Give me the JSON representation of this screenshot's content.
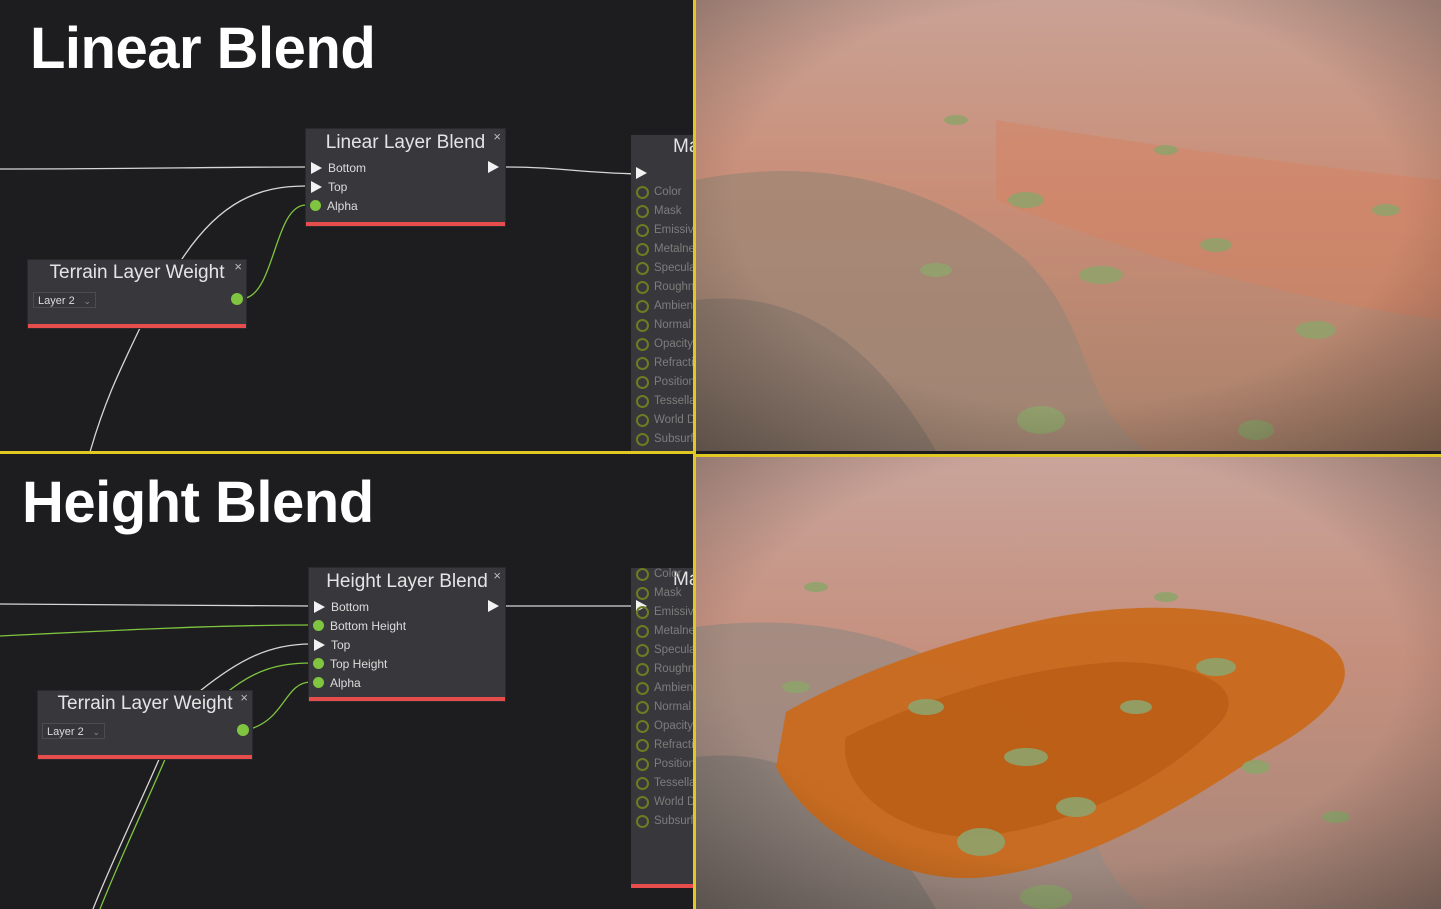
{
  "linear": {
    "title": "Linear Blend",
    "blend_node": {
      "title": "Linear Layer Blend",
      "close": "×",
      "pins": [
        "Bottom",
        "Top",
        "Alpha"
      ]
    },
    "weight_node": {
      "title": "Terrain Layer Weight",
      "close": "×",
      "layer": "Layer 2"
    },
    "material_node": {
      "title": "Ma",
      "pins": [
        "Color",
        "Mask",
        "Emissiv",
        "Metalne",
        "Specula",
        "Roughn",
        "Ambien",
        "Normal",
        "Opacity",
        "Refracti",
        "Position",
        "Tessella",
        "World D",
        "Subsurf"
      ]
    }
  },
  "height": {
    "title": "Height Blend",
    "blend_node": {
      "title": "Height Layer Blend",
      "close": "×",
      "pins": [
        "Bottom",
        "Bottom Height",
        "Top",
        "Top Height",
        "Alpha"
      ]
    },
    "weight_node": {
      "title": "Terrain Layer Weight",
      "close": "×",
      "layer": "Layer 2"
    },
    "material_node": {
      "title": "Ma",
      "pins": [
        "Color",
        "Mask",
        "Emissiv",
        "Metalne",
        "Specula",
        "Roughn",
        "Ambien",
        "Normal",
        "Opacity",
        "Refracti",
        "Position",
        "Tessella",
        "World D",
        "Subsurf"
      ]
    }
  },
  "colors": {
    "accent_bar": "#e84d4d",
    "pin_green": "#7fc540",
    "divider": "#e2c823",
    "background": "#1d1d1f"
  }
}
